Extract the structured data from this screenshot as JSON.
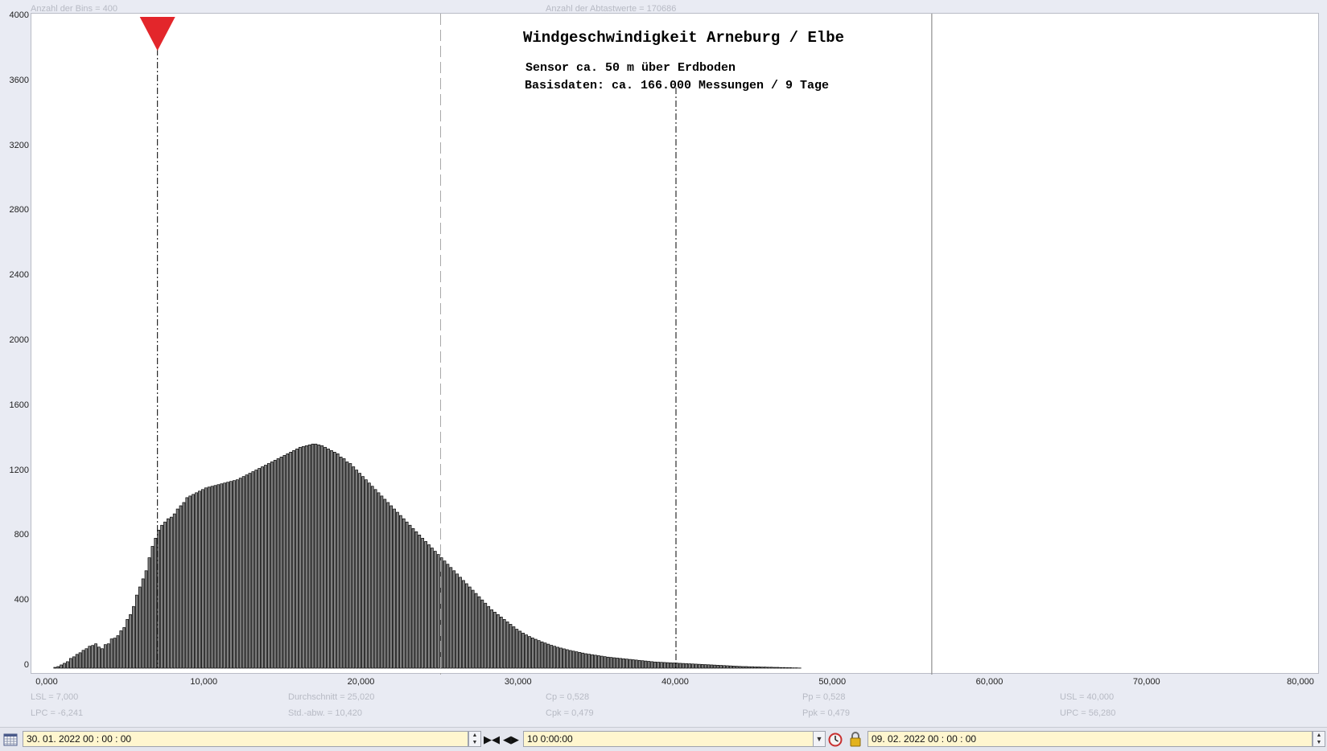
{
  "header": {
    "bins_label": "Anzahl der Bins =  400",
    "samples_label": "Anzahl der Abtastwerte = 170686"
  },
  "chart_data": {
    "type": "bar",
    "title": "Windgeschwindigkeit  Arneburg / Elbe",
    "subtitle_lines": [
      "Sensor ca. 50 m über Erdboden",
      "Basisdaten:  ca. 166.000 Messungen / 9 Tage"
    ],
    "xlabel": "",
    "ylabel": "",
    "xlim": [
      0,
      80
    ],
    "ylim": [
      0,
      4000
    ],
    "yticks": [
      "0",
      "400",
      "800",
      "1200",
      "1600",
      "2000",
      "2400",
      "2800",
      "3200",
      "3600",
      "4000"
    ],
    "xticks": [
      "0,000",
      "10,000",
      "20,000",
      "30,000",
      "40,000",
      "50,000",
      "60,000",
      "70,000",
      "80,000"
    ],
    "bin_width": 0.2,
    "bin_start": 0.2,
    "series": [
      {
        "values": [
          0,
          5,
          10,
          20,
          30,
          40,
          60,
          70,
          85,
          95,
          110,
          120,
          135,
          140,
          150,
          130,
          120,
          145,
          150,
          180,
          185,
          200,
          230,
          250,
          300,
          330,
          380,
          450,
          500,
          550,
          600,
          680,
          750,
          800,
          850,
          880,
          900,
          920,
          930,
          950,
          980,
          1000,
          1020,
          1050,
          1060,
          1070,
          1080,
          1090,
          1100,
          1110,
          1115,
          1120,
          1125,
          1130,
          1135,
          1140,
          1145,
          1150,
          1155,
          1160,
          1170,
          1180,
          1190,
          1200,
          1210,
          1220,
          1230,
          1240,
          1250,
          1260,
          1270,
          1280,
          1290,
          1300,
          1310,
          1320,
          1330,
          1340,
          1350,
          1360,
          1365,
          1370,
          1375,
          1380,
          1380,
          1375,
          1370,
          1360,
          1350,
          1340,
          1330,
          1320,
          1300,
          1290,
          1270,
          1260,
          1240,
          1220,
          1200,
          1180,
          1160,
          1140,
          1120,
          1100,
          1080,
          1060,
          1040,
          1020,
          1000,
          980,
          960,
          940,
          920,
          900,
          880,
          860,
          840,
          820,
          800,
          780,
          760,
          740,
          720,
          700,
          680,
          660,
          640,
          620,
          600,
          580,
          560,
          540,
          520,
          500,
          480,
          460,
          440,
          420,
          400,
          380,
          360,
          345,
          330,
          315,
          300,
          285,
          270,
          255,
          240,
          228,
          216,
          205,
          195,
          186,
          178,
          170,
          162,
          155,
          148,
          141,
          135,
          129,
          124,
          119,
          114,
          109,
          105,
          101,
          97,
          93,
          89,
          86,
          83,
          80,
          77,
          74,
          71,
          68,
          66,
          64,
          62,
          60,
          58,
          56,
          54,
          52,
          50,
          48,
          46,
          44,
          42,
          40,
          38,
          37,
          36,
          35,
          34,
          33,
          32,
          31,
          30,
          29,
          28,
          27,
          26,
          25,
          24,
          23,
          22,
          21,
          20,
          19,
          18,
          17,
          16,
          15,
          14,
          13,
          12,
          11,
          10,
          10,
          9,
          9,
          8,
          8,
          7,
          7,
          6,
          6,
          5,
          5,
          4,
          4,
          3,
          3,
          2,
          2,
          1
        ]
      }
    ],
    "reference_lines": [
      {
        "x": 7.0,
        "style": "dash-dot",
        "marker": "red-triangle"
      },
      {
        "x": 25.02,
        "style": "dashed"
      },
      {
        "x": 40.0,
        "style": "dash-dot"
      },
      {
        "x": 56.28,
        "style": "solid"
      }
    ],
    "grid": false,
    "bar_color": "#808080",
    "bar_outline": "#000000",
    "marker_color": "#e3262b"
  },
  "stats": [
    {
      "label": "LSL = 7,000"
    },
    {
      "label": "LPC = -6,241"
    },
    {
      "label": "Durchschnitt  = 25,020"
    },
    {
      "label": "Std.-abw. = 10,420"
    },
    {
      "label": "Cp  = 0,528"
    },
    {
      "label": "Cpk = 0,479"
    },
    {
      "label": "Pp  = 0,528"
    },
    {
      "label": "Ppk = 0,479"
    },
    {
      "label": "USL = 40,000"
    },
    {
      "label": "UPC = 56,280"
    }
  ],
  "toolbar": {
    "start_date": "30. 01. 2022    00 : 00 : 00",
    "duration": "10  0:00:00",
    "end_date": "09. 02. 2022    00 : 00 : 00",
    "shrink_glyph": "▶◀",
    "expand_glyph": "◀▶",
    "spin_up": "▲",
    "spin_down": "▼",
    "dropdown_glyph": "▼"
  }
}
